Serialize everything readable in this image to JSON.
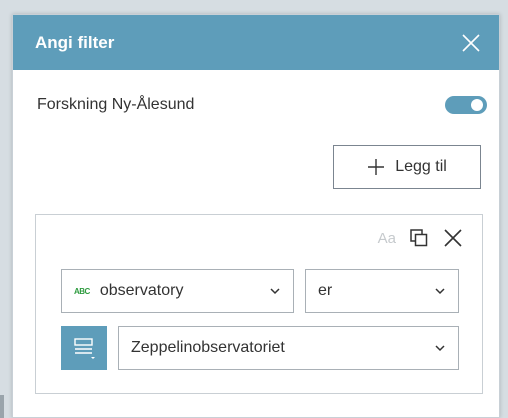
{
  "dialog": {
    "title": "Angi filter"
  },
  "layer": {
    "name": "Forskning Ny-Ålesund",
    "enabled": true
  },
  "add_button": {
    "label": "Legg til"
  },
  "expression": {
    "case_sensitive_label": "Aa",
    "field": {
      "type_badge": "ABC",
      "value": "observatory"
    },
    "operator": {
      "value": "er"
    },
    "value": {
      "value": "Zeppelinobservatoriet"
    }
  },
  "colors": {
    "accent": "#5e9dba",
    "string_type": "#2e9b3f"
  },
  "icons": {
    "close": "close-icon",
    "plus": "plus-icon",
    "copy": "copy-icon",
    "delete": "delete-icon",
    "chevron": "chevron-down-icon",
    "value_mode": "list-mode-icon"
  }
}
